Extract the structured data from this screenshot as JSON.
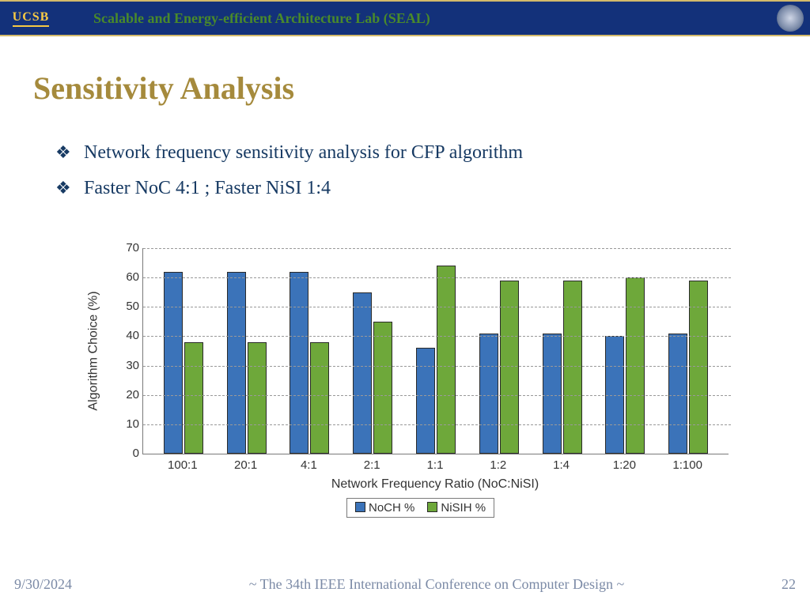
{
  "header": {
    "logo_text": "UCSB",
    "lab_name": "Scalable and Energy-efficient Architecture Lab (SEAL)"
  },
  "title": "Sensitivity Analysis",
  "bullets": [
    "Network frequency sensitivity analysis for CFP algorithm",
    "Faster NoC 4:1 ; Faster NiSI 1:4"
  ],
  "footer": {
    "date": "9/30/2024",
    "conference": "~ The 34th IEEE International Conference on Computer Design ~",
    "page": "22"
  },
  "chart_data": {
    "type": "bar",
    "title": "",
    "xlabel": "Network Frequency Ratio (NoC:NiSI)",
    "ylabel": "Algorithm Choice (%)",
    "ylim": [
      0,
      70
    ],
    "ytick_step": 10,
    "categories": [
      "100:1",
      "20:1",
      "4:1",
      "2:1",
      "1:1",
      "1:2",
      "1:4",
      "1:20",
      "1:100"
    ],
    "series": [
      {
        "name": "NoCH %",
        "color": "#3b73b9",
        "values": [
          62,
          62,
          62,
          55,
          36,
          41,
          41,
          40,
          41
        ]
      },
      {
        "name": "NiSIH %",
        "color": "#6ea83a",
        "values": [
          38,
          38,
          38,
          45,
          64,
          59,
          59,
          60,
          59
        ]
      }
    ],
    "legend_position": "bottom",
    "grid": true
  }
}
